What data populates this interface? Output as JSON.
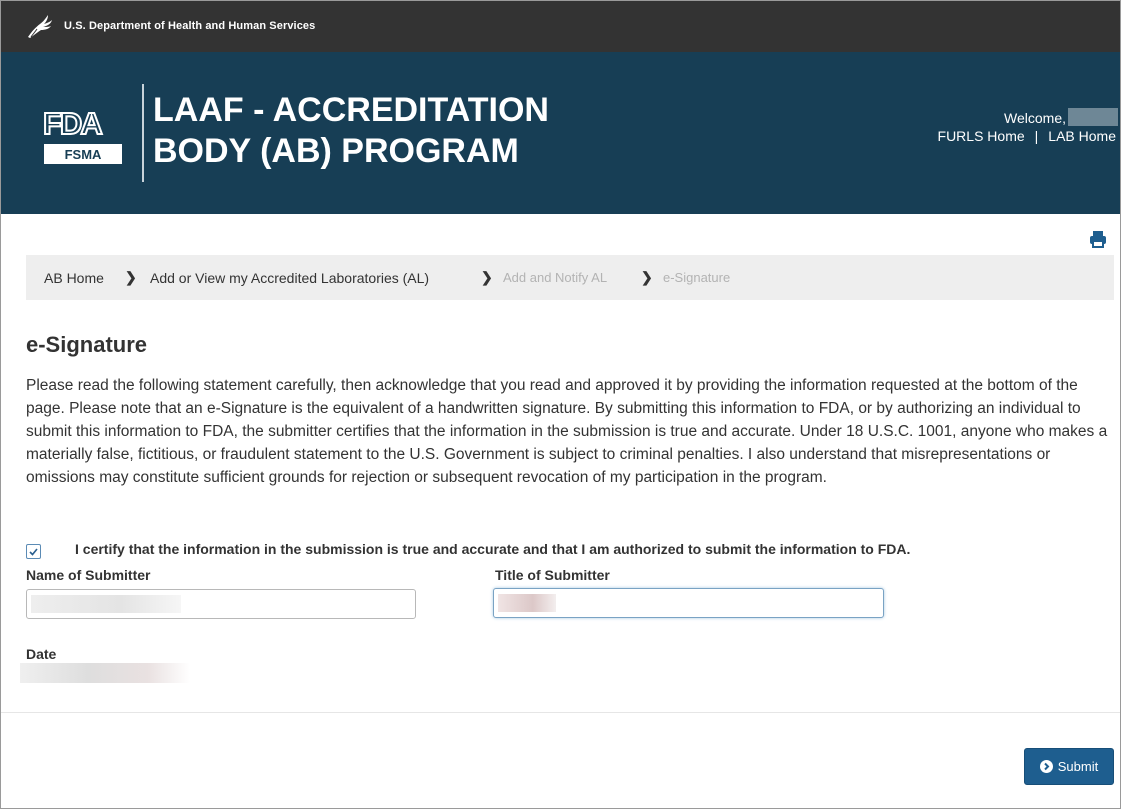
{
  "gov_bar": {
    "department": "U.S. Department of Health and Human Services"
  },
  "header": {
    "logo_fsma": "FSMA",
    "app_title_line1": "LAAF - ACCREDITATION",
    "app_title_line2": "BODY (AB) PROGRAM",
    "welcome": "Welcome,",
    "links": [
      "FURLS Home",
      "LAB Home"
    ],
    "link_separator": "|",
    "background_color": "#173e55"
  },
  "breadcrumb": {
    "items": [
      {
        "label": "AB Home",
        "state": "link"
      },
      {
        "label": "Add or View my Accredited Laboratories (AL)",
        "state": "link"
      },
      {
        "label": "Add and Notify AL",
        "state": "muted"
      },
      {
        "label": "e-Signature",
        "state": "muted"
      }
    ]
  },
  "page": {
    "title": "e-Signature",
    "statement": "Please read the following statement carefully, then acknowledge that you read and approved it by providing the information requested at the bottom of the page. Please note that an e-Signature is the equivalent of a handwritten signature. By submitting this information to FDA, or by authorizing an individual to submit this information to FDA, the submitter certifies that the information in the submission is true and accurate. Under 18 U.S.C. 1001, anyone who makes a materially false, fictitious, or fraudulent statement to the U.S. Government is subject to criminal penalties. I also understand that misrepresentations or omissions may constitute sufficient grounds for rejection or subsequent revocation of my participation in the program."
  },
  "form": {
    "certify_checked": true,
    "certify_label": "I certify that the information in the submission is true and accurate and that I am authorized to submit the information to FDA.",
    "name_label": "Name of Submitter",
    "title_label": "Title of Submitter",
    "date_label": "Date"
  },
  "actions": {
    "submit_label": "Submit",
    "submit_color": "#1e5e8f"
  },
  "icons": [
    "hhs-eagle-icon",
    "fda-fsma-logo",
    "print-icon",
    "chevron-right-icon",
    "checkmark-icon",
    "arrow-circle-right-icon"
  ]
}
